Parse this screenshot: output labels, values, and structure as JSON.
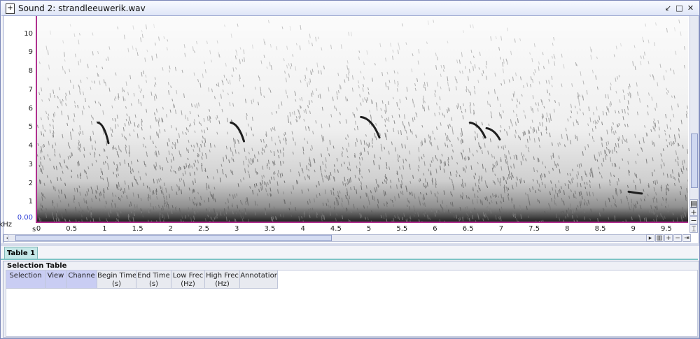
{
  "window": {
    "title": "Sound 2: strandleeuwerik.wav"
  },
  "spectrogram": {
    "y_unit": "kHz",
    "x_unit": "s",
    "y_ticks": [
      "10",
      "9",
      "8",
      "7",
      "6",
      "5",
      "4",
      "3",
      "2",
      "1"
    ],
    "y_zero": "0.00",
    "x_ticks": [
      "0",
      "0.5",
      "1",
      "1.5",
      "2",
      "2.5",
      "3",
      "3.5",
      "4",
      "4.5",
      "5",
      "5.5",
      "6",
      "6.5",
      "7",
      "7.5",
      "8",
      "8.5",
      "9",
      "9.5"
    ],
    "y_range_khz": [
      0,
      11
    ],
    "x_range_s": [
      0,
      9.85
    ],
    "calls": [
      {
        "t": 0.92,
        "f1": 5.3,
        "t2": 1.08,
        "f2": 4.2
      },
      {
        "t": 2.93,
        "f1": 5.3,
        "t2": 3.13,
        "f2": 4.3
      },
      {
        "t": 4.9,
        "f1": 5.6,
        "t2": 5.18,
        "f2": 4.5
      },
      {
        "t": 6.55,
        "f1": 5.3,
        "t2": 6.78,
        "f2": 4.5
      },
      {
        "t": 6.8,
        "f1": 5.0,
        "t2": 7.0,
        "f2": 4.4
      },
      {
        "t": 8.95,
        "f1": 1.6,
        "t2": 9.15,
        "f2": 1.5
      }
    ]
  },
  "tabs": {
    "table1": "Table 1"
  },
  "selection_table": {
    "title": "Selection Table",
    "columns": [
      {
        "label": "Selection",
        "highlight": true
      },
      {
        "label": "View",
        "highlight": true
      },
      {
        "label": "Channe",
        "highlight": true
      },
      {
        "label": "Begin Time\n(s)",
        "highlight": false
      },
      {
        "label": "End Time\n(s)",
        "highlight": false
      },
      {
        "label": "Low Frec\n(Hz)",
        "highlight": false
      },
      {
        "label": "High Frec\n(Hz)",
        "highlight": false
      },
      {
        "label": "Annotatior",
        "highlight": false
      }
    ]
  },
  "colors": {
    "axis": "#b0308f",
    "y_zero_label": "#2a3bd6",
    "tab_active": "#c6e8e8"
  },
  "icons": {
    "title": "sound-file-icon",
    "restore": "restore-icon",
    "maximize": "maximize-icon",
    "close": "close-icon"
  }
}
